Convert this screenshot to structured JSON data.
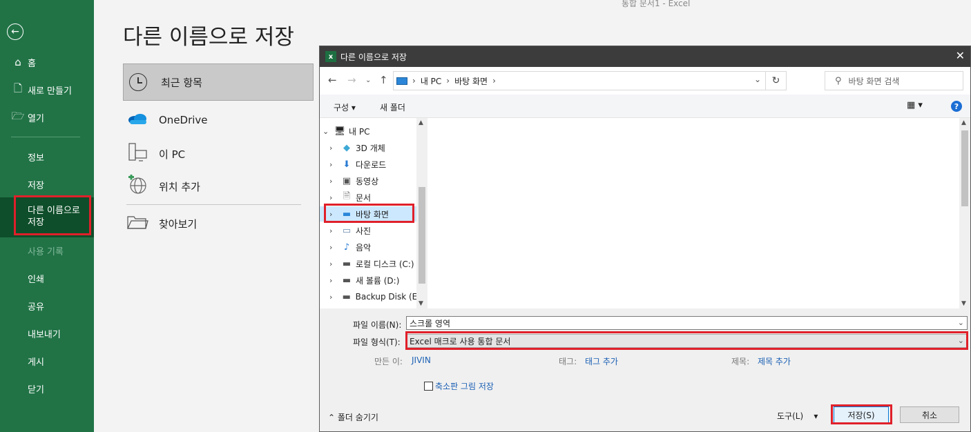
{
  "window": {
    "title": "통합 문서1  -  Excel"
  },
  "sidebar": {
    "back_icon": "back-arrow-icon",
    "items": [
      {
        "label": "홈",
        "icon": "home-icon"
      },
      {
        "label": "새로 만들기",
        "icon": "new-document-icon"
      },
      {
        "label": "열기",
        "icon": "open-folder-icon"
      },
      {
        "label": "정보"
      },
      {
        "label": "저장"
      },
      {
        "label": "다른 이름으로\n저장",
        "active": true
      },
      {
        "label": "사용 기록",
        "disabled": true
      },
      {
        "label": "인쇄"
      },
      {
        "label": "공유"
      },
      {
        "label": "내보내기"
      },
      {
        "label": "게시"
      },
      {
        "label": "닫기"
      }
    ]
  },
  "main": {
    "title": "다른 이름으로 저장",
    "locations": [
      {
        "label": "최근 항목",
        "icon": "clock-icon",
        "selected": true
      },
      {
        "label": "OneDrive",
        "icon": "cloud-icon"
      },
      {
        "label": "이 PC",
        "icon": "computer-icon"
      },
      {
        "label": "위치 추가",
        "icon": "add-location-icon"
      },
      {
        "label": "찾아보기",
        "icon": "browse-folder-icon"
      }
    ]
  },
  "dialog": {
    "title": "다른 이름으로 저장",
    "breadcrumb": [
      "내 PC",
      "바탕 화면"
    ],
    "search_placeholder": "바탕 화면 검색",
    "toolbar": {
      "organize": "구성",
      "new_folder": "새 폴더"
    },
    "tree": [
      {
        "label": "내 PC",
        "icon": "computer-icon",
        "expanded": true
      },
      {
        "label": "3D 개체",
        "icon": "cube-icon"
      },
      {
        "label": "다운로드",
        "icon": "download-icon"
      },
      {
        "label": "동영상",
        "icon": "video-icon"
      },
      {
        "label": "문서",
        "icon": "document-icon"
      },
      {
        "label": "바탕 화면",
        "icon": "desktop-icon",
        "selected": true
      },
      {
        "label": "사진",
        "icon": "pictures-icon"
      },
      {
        "label": "음악",
        "icon": "music-icon"
      },
      {
        "label": "로컬 디스크 (C:)",
        "icon": "drive-icon"
      },
      {
        "label": "새 볼륨 (D:)",
        "icon": "drive-icon"
      },
      {
        "label": "Backup Disk (E:)",
        "icon": "drive-icon"
      }
    ],
    "filename_label": "파일 이름(N):",
    "filename_value": "스크롤 영역",
    "filetype_label": "파일 형식(T):",
    "filetype_value": "Excel 매크로 사용 통합 문서",
    "author_label": "만든 이:",
    "author_value": "JIVIN",
    "tags_label": "태그:",
    "tags_value": "태그 추가",
    "title_label": "제목:",
    "title_value": "제목 추가",
    "thumbnail_label": "축소판 그림 저장",
    "thumbnail_checked": false,
    "hide_folders_label": "폴더 숨기기",
    "tools_label": "도구(L)",
    "save_label": "저장(S)",
    "cancel_label": "취소"
  },
  "colors": {
    "excel_green": "#217346",
    "highlight_red": "#e0202a",
    "selection_blue": "#cce8ff"
  }
}
